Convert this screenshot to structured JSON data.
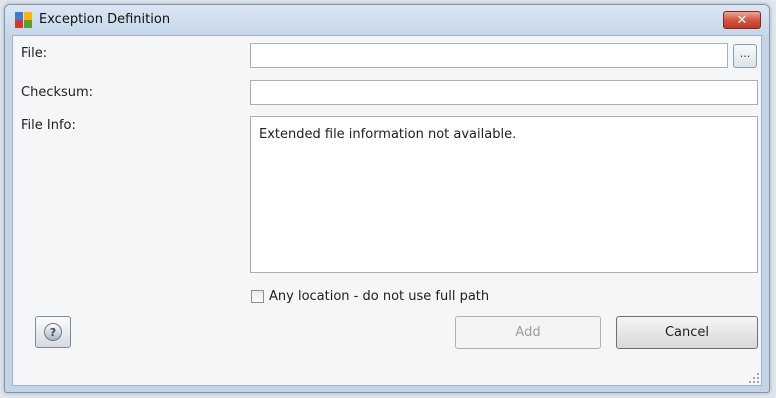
{
  "window": {
    "title": "Exception Definition",
    "icons": {
      "app": "avg-logo-icon",
      "close": "close-icon"
    },
    "close_glyph": "✕"
  },
  "form": {
    "file_label": "File:",
    "file_value": "",
    "browse_label": "...",
    "checksum_label": "Checksum:",
    "checksum_value": "",
    "file_info_label": "File Info:",
    "file_info_text": "Extended file information not available.",
    "any_location_label": "Any location - do not use full path",
    "any_location_checked": false
  },
  "buttons": {
    "help_glyph": "?",
    "add_label": "Add",
    "add_enabled": false,
    "cancel_label": "Cancel"
  },
  "colors": {
    "title_bar": "#c5d7ea",
    "close_button": "#d5553f",
    "client_bg": "#f5f6f7"
  }
}
